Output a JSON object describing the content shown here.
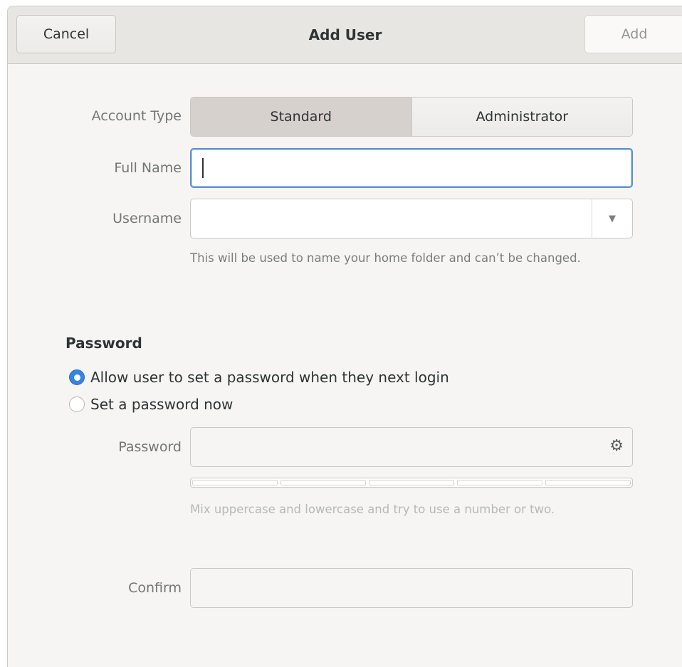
{
  "header": {
    "cancel_label": "Cancel",
    "title": "Add User",
    "add_label": "Add"
  },
  "account_type": {
    "label": "Account Type",
    "options": [
      "Standard",
      "Administrator"
    ],
    "selected": "Standard"
  },
  "full_name": {
    "label": "Full Name",
    "value": ""
  },
  "username": {
    "label": "Username",
    "value": "",
    "hint": "This will be used to name your home folder and can’t be changed."
  },
  "password_section": {
    "title": "Password",
    "options": [
      "Allow user to set a password when they next login",
      "Set a password now"
    ],
    "selected_index": 0
  },
  "password": {
    "label": "Password",
    "value": "",
    "icon": "generate-password-icon",
    "strength_level": 0,
    "hint": "Mix uppercase and lowercase and try to use a number or two."
  },
  "confirm": {
    "label": "Confirm",
    "value": ""
  },
  "colors": {
    "accent": "#3584e4",
    "focus": "#5b8fd6"
  }
}
